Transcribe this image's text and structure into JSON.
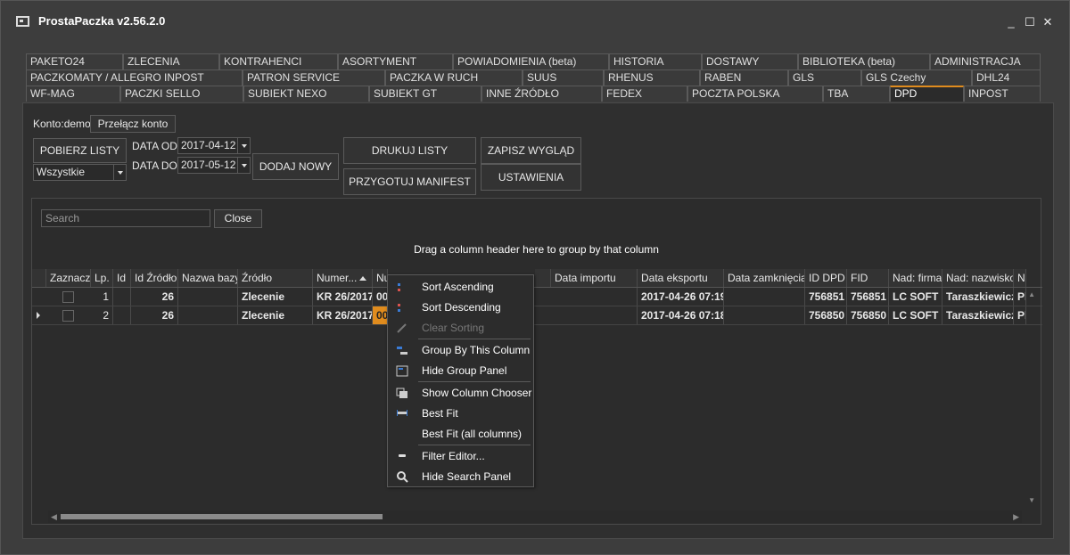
{
  "window": {
    "title": "ProstaPaczka v2.56.2.0",
    "minimize": "_",
    "maximize": "☐",
    "close": "✕"
  },
  "tabs": {
    "row1": [
      "PAKETO24",
      "ZLECENIA",
      "KONTRAHENCI",
      "ASORTYMENT",
      "POWIADOMIENIA (beta)",
      "HISTORIA",
      "DOSTAWY",
      "BIBLIOTEKA (beta)",
      "ADMINISTRACJA"
    ],
    "row2": [
      "PACZKOMATY / ALLEGRO INPOST",
      "PATRON SERVICE",
      "PACZKA W RUCH",
      "SUUS",
      "RHENUS",
      "RABEN",
      "GLS",
      "GLS Czechy",
      "DHL24"
    ],
    "row3": [
      "WF-MAG",
      "PACZKI SELLO",
      "SUBIEKT NEXO",
      "SUBIEKT GT",
      "INNE ŹRÓDŁO",
      "FEDEX",
      "POCZTA POLSKA",
      "TBA",
      "DPD",
      "INPOST"
    ],
    "active": "DPD"
  },
  "toolbar": {
    "konto_label": "Konto:demo",
    "switch_account": "Przełącz konto",
    "get_lists": "POBIERZ LISTY",
    "filter_value": "Wszystkie",
    "date_from_label": "DATA OD",
    "date_from": "2017-04-12",
    "date_to_label": "DATA DO",
    "date_to": "2017-05-12",
    "add_new": "DODAJ NOWY",
    "print_lists": "DRUKUJ LISTY",
    "prepare_manifest": "PRZYGOTUJ MANIFEST",
    "save_layout": "ZAPISZ WYGLĄD",
    "settings": "USTAWIENIA"
  },
  "grid": {
    "search_placeholder": "Search",
    "close": "Close",
    "group_hint": "Drag a column header here to group by that column",
    "columns": [
      "Zaznacz",
      "Lp.",
      "Id",
      "Id Źródło",
      "Nazwa bazy",
      "Źródło",
      "Numer...",
      "Nu...",
      "",
      "Data importu",
      "Data eksportu",
      "Data zamknięcia",
      "ID DPD",
      "FID",
      "Nad: firma",
      "Nad: nazwisko",
      "N"
    ],
    "rows": [
      {
        "lp": "1",
        "id_zrodlo": "26",
        "zrodlo": "Zlecenie",
        "numer": "KR 26/2017",
        "nu": "00",
        "data_eksportu": "2017-04-26 07:19",
        "id_dpd": "756851",
        "fid": "756851",
        "firma": "LC SOFT",
        "nazwisko": "Taraszkiewicz",
        "extra": "Pl"
      },
      {
        "lp": "2",
        "id_zrodlo": "26",
        "zrodlo": "Zlecenie",
        "numer": "KR 26/2017",
        "nu": "00",
        "data_eksportu": "2017-04-26 07:18",
        "id_dpd": "756850",
        "fid": "756850",
        "firma": "LC SOFT",
        "nazwisko": "Taraszkiewicz",
        "extra": "Pl"
      }
    ]
  },
  "context_menu": {
    "items": [
      "Sort Ascending",
      "Sort Descending",
      "Clear Sorting",
      "Group By This Column",
      "Hide Group Panel",
      "Show Column Chooser",
      "Best Fit",
      "Best Fit (all columns)",
      "Filter Editor...",
      "Hide Search Panel"
    ]
  },
  "colors": {
    "accent": "#e08c1e",
    "background": "#3d3d3d",
    "panel": "#2f2f2f"
  }
}
